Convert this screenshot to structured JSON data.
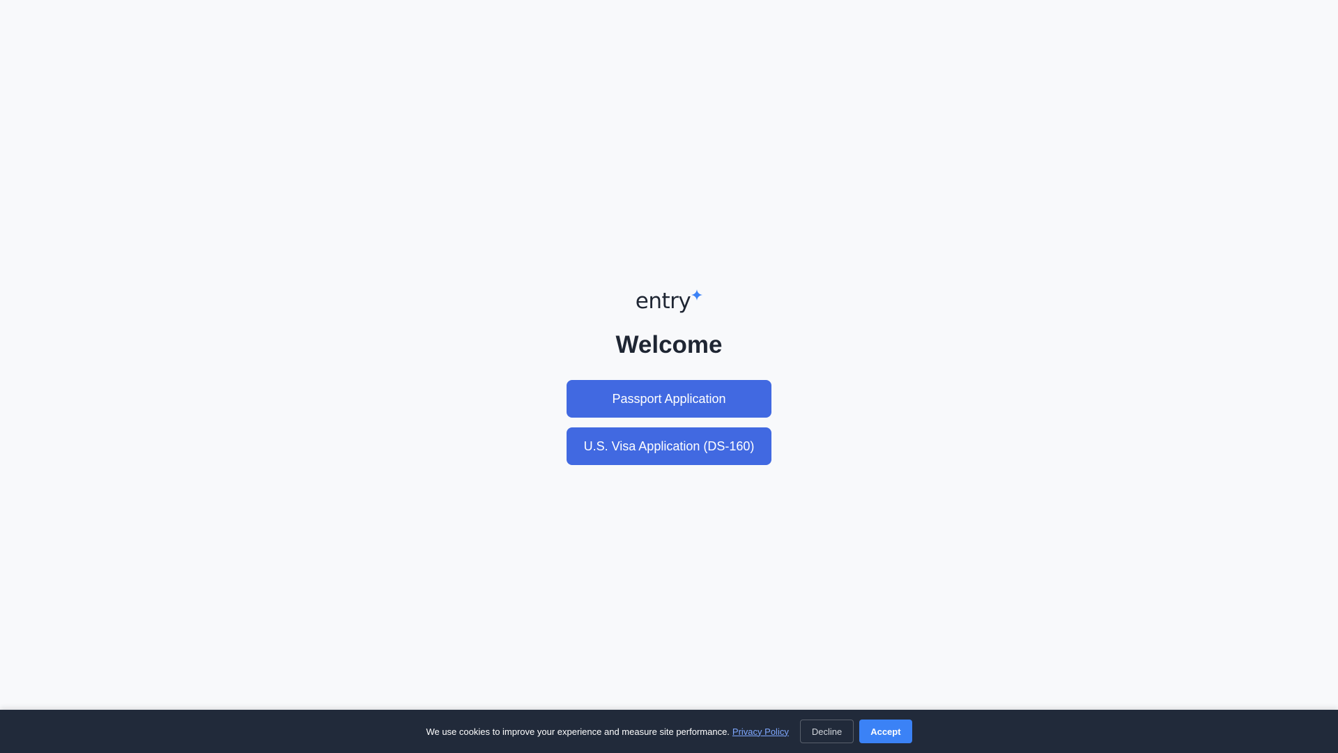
{
  "brand": {
    "name": "entry",
    "star_icon": "sparkle-icon",
    "star_color": "#3b82f6",
    "text_color": "#1f2633"
  },
  "main": {
    "heading": "Welcome",
    "buttons": [
      {
        "label": "Passport Application"
      },
      {
        "label": "U.S. Visa Application (DS-160)"
      }
    ],
    "button_color": "#4169e1"
  },
  "cookie_banner": {
    "message": "We use cookies to improve your experience and measure site performance.",
    "privacy_link": "Privacy Policy",
    "decline_label": "Decline",
    "accept_label": "Accept",
    "background": "#212a3a",
    "accept_color": "#3b82f6"
  }
}
